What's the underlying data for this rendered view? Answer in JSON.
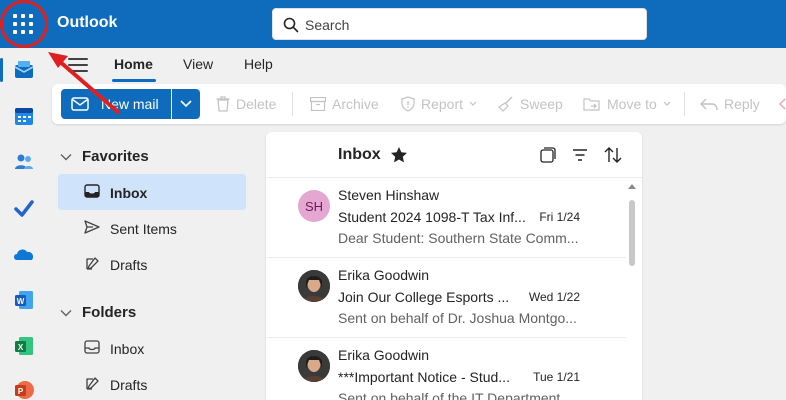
{
  "app": {
    "title": "Outlook"
  },
  "search": {
    "placeholder": "Search"
  },
  "ribbon": {
    "tabs": [
      {
        "label": "Home",
        "active": true
      },
      {
        "label": "View",
        "active": false
      },
      {
        "label": "Help",
        "active": false
      }
    ]
  },
  "toolbar": {
    "new_mail": "New mail",
    "delete": "Delete",
    "archive": "Archive",
    "report": "Report",
    "sweep": "Sweep",
    "move_to": "Move to",
    "reply": "Reply"
  },
  "folders": {
    "favorites_label": "Favorites",
    "favorites": [
      {
        "label": "Inbox",
        "icon": "inbox-icon",
        "selected": true
      },
      {
        "label": "Sent Items",
        "icon": "send-icon",
        "selected": false
      },
      {
        "label": "Drafts",
        "icon": "drafts-icon",
        "selected": false
      }
    ],
    "folders_label": "Folders",
    "folders": [
      {
        "label": "Inbox",
        "icon": "inbox-icon"
      },
      {
        "label": "Drafts",
        "icon": "drafts-icon"
      }
    ]
  },
  "message_list": {
    "title": "Inbox",
    "messages": [
      {
        "sender": "Steven Hinshaw",
        "initials": "SH",
        "subject": "Student 2024 1098-T Tax Inf...",
        "date": "Fri 1/24",
        "preview": "Dear Student: Southern State Comm..."
      },
      {
        "sender": "Erika Goodwin",
        "subject": "Join Our College Esports ...",
        "date": "Wed 1/22",
        "preview": "Sent on behalf of Dr. Joshua Montgo..."
      },
      {
        "sender": "Erika Goodwin",
        "subject": "***Important Notice - Stud...",
        "date": "Tue 1/21",
        "preview": "Sent on behalf of the IT Department..."
      }
    ]
  },
  "colors": {
    "brand": "#0f6cbd",
    "selected_folder": "#cfe4fa",
    "annotation": "#e02020"
  }
}
